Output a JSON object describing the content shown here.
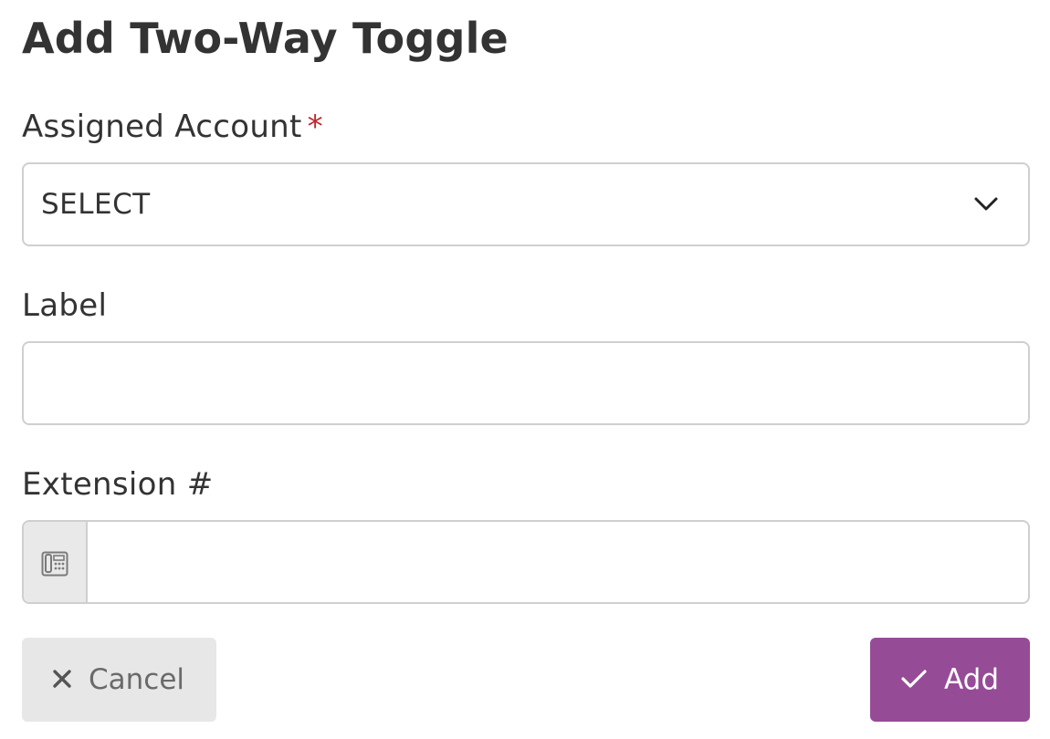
{
  "dialog": {
    "title": "Add Two-Way Toggle"
  },
  "fields": {
    "assigned_account": {
      "label": "Assigned Account",
      "required_marker": "*",
      "selected_value": "SELECT"
    },
    "label": {
      "label": "Label",
      "value": ""
    },
    "extension": {
      "label": "Extension #",
      "value": "",
      "icon": "desk-phone-icon"
    }
  },
  "actions": {
    "cancel": {
      "icon": "close-icon",
      "label": "Cancel"
    },
    "add": {
      "icon": "check-icon",
      "label": "Add"
    }
  },
  "colors": {
    "primary": "#964b97",
    "required": "#c0282d",
    "border": "#cfcfcf",
    "cancel_bg": "#e7e7e7"
  }
}
